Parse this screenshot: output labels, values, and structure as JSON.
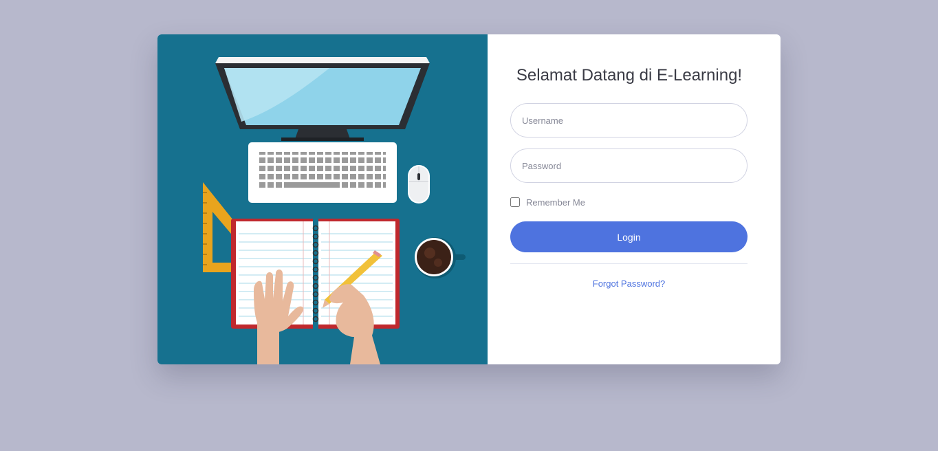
{
  "colors": {
    "page_background": "#b7b8cc",
    "illustration_background": "#16718f",
    "primary": "#4e73df",
    "title_text": "#3a3b45",
    "muted_text": "#858796"
  },
  "illustration": {
    "icon": "desk-workspace-illustration"
  },
  "login": {
    "title": "Selamat Datang di E-Learning!",
    "username_placeholder": "Username",
    "username_value": "",
    "password_placeholder": "Password",
    "password_value": "",
    "remember_label": "Remember Me",
    "remember_checked": false,
    "button_label": "Login",
    "forgot_link": "Forgot Password?"
  }
}
